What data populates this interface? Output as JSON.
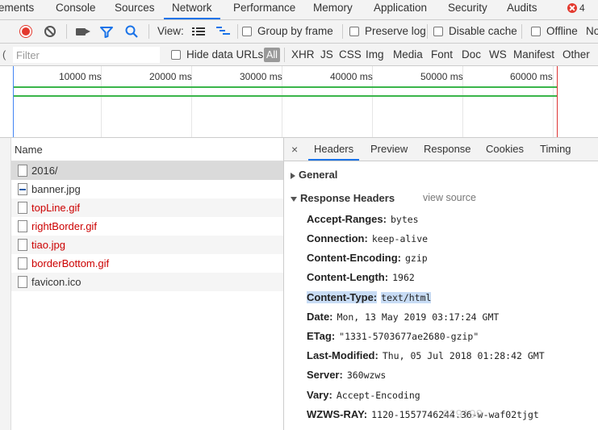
{
  "panel_tabs": [
    "ements",
    "Console",
    "Sources",
    "Network",
    "Performance",
    "Memory",
    "Application",
    "Security",
    "Audits"
  ],
  "active_panel_tab": "Network",
  "error_count": "4",
  "toolbar": {
    "view_label": "View:",
    "group_by_frame": "Group by frame",
    "preserve_log": "Preserve log",
    "disable_cache": "Disable cache",
    "offline": "Offline",
    "throttle": "No"
  },
  "filter": {
    "placeholder": "Filter",
    "hide_data_urls": "Hide data URLs",
    "all": "All",
    "types": [
      "XHR",
      "JS",
      "CSS",
      "Img",
      "Media",
      "Font",
      "Doc",
      "WS",
      "Manifest",
      "Other"
    ]
  },
  "overview": {
    "ticks": [
      "10000 ms",
      "20000 ms",
      "30000 ms",
      "40000 ms",
      "50000 ms",
      "60000 ms"
    ]
  },
  "list": {
    "header": "Name",
    "rows": [
      {
        "name": "2016/",
        "icon": "document-icon",
        "color": "#333333"
      },
      {
        "name": "banner.jpg",
        "icon": "image-file-icon",
        "color": "#333333"
      },
      {
        "name": "topLine.gif",
        "icon": "document-icon",
        "color": "#cc0000"
      },
      {
        "name": "rightBorder.gif",
        "icon": "document-icon",
        "color": "#cc0000"
      },
      {
        "name": "tiao.jpg",
        "icon": "document-icon",
        "color": "#cc0000"
      },
      {
        "name": "borderBottom.gif",
        "icon": "document-icon",
        "color": "#cc0000"
      },
      {
        "name": "favicon.ico",
        "icon": "document-icon",
        "color": "#333333"
      }
    ]
  },
  "details": {
    "tabs": [
      "Headers",
      "Preview",
      "Response",
      "Cookies",
      "Timing"
    ],
    "active_tab": "Headers",
    "close": "×",
    "general": "General",
    "response_headers": "Response Headers",
    "view_source": "view source",
    "headers": [
      {
        "key": "Accept-Ranges:",
        "value": "bytes"
      },
      {
        "key": "Connection:",
        "value": "keep-alive"
      },
      {
        "key": "Content-Encoding:",
        "value": "gzip"
      },
      {
        "key": "Content-Length:",
        "value": "1962"
      },
      {
        "key": "Content-Type:",
        "value": "text/html"
      },
      {
        "key": "Date:",
        "value": "Mon, 13 May 2019 03:17:24 GMT"
      },
      {
        "key": "ETag:",
        "value": "\"1331-5703677ae2680-gzip\""
      },
      {
        "key": "Last-Modified:",
        "value": "Thu, 05 Jul 2018 01:28:42 GMT"
      },
      {
        "key": "Server:",
        "value": "360wzws"
      },
      {
        "key": "Vary:",
        "value": "Accept-Encoding"
      },
      {
        "key": "WZWS-RAY:",
        "value": "1120-1557746244.36-w-waf02tjgt"
      }
    ],
    "highlighted_header": "Content-Type:"
  },
  "watermark": "629199",
  "colors": {
    "accent": "#1a73e8",
    "record": "#e3392e",
    "error_file": "#cc0000",
    "timeline_bar": "#3ab54a",
    "highlight": "#c8dcf5"
  }
}
